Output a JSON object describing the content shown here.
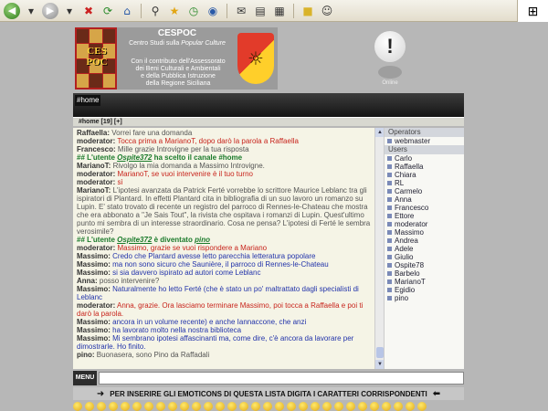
{
  "banner": {
    "title": "CESPOC",
    "subtitle_pre": "Centro Studi sulla ",
    "subtitle_em": "Popular Culture",
    "logo_text": "CES POC",
    "desc": [
      "Con il contributo dell'Assessorato",
      "dei Beni Culturali e Ambientali",
      "e della Pubblica Istruzione",
      "della Regione Siciliana"
    ]
  },
  "alert": {
    "label": "Online"
  },
  "tabs": {
    "home": "#home"
  },
  "channel": {
    "label": "#home [19] [+]"
  },
  "chat": [
    {
      "nick": "Raffaella:",
      "text": " Vorrei fare una domanda",
      "color": "c-gray"
    },
    {
      "nick": "moderator:",
      "text": " Tocca prima a MarianoT, dopo darò la parola a Raffaella",
      "color": "c-red"
    },
    {
      "nick": "Francesco:",
      "text": " Mille grazie Introvigne per la tua risposta",
      "color": "c-gray"
    },
    {
      "sys": true,
      "pre": "## L'utente ",
      "user": "Ospite372",
      "post": " ha scelto il canale #home"
    },
    {
      "nick": "MarianoT:",
      "text": " Rivolgo la mia domanda a Massimo Introvigne.",
      "color": "c-gray"
    },
    {
      "nick": "moderator:",
      "text": " MarianoT, se vuoi intervenire è il tuo turno",
      "color": "c-red"
    },
    {
      "nick": "moderator:",
      "text": " sì",
      "color": "c-red"
    },
    {
      "nick": "MarianoT:",
      "text": " L'ipotesi avanzata da Patrick Ferté vorrebbe lo scrittore Maurice Leblanc tra gli ispiratori di Plantard. In effetti Plantard cita in bibliografia di un suo lavoro un romanzo su Lupin. E' stato trovato di recente un registro del parroco di Rennes-le-Chateau che mostra che era abbonato a \"Je Sais Tout\", la rivista che ospitava i romanzi di Lupin. Quest'ultimo punto mi sembra di un interesse straordinario. Cosa ne pensa? L'ipotesi di Ferté le sembra verosimile?",
      "color": "c-gray"
    },
    {
      "sys": true,
      "pre": "## L'utente ",
      "user": "Ospite372",
      "post": " è diventato ",
      "user2": "pino"
    },
    {
      "nick": "moderator:",
      "text": " Massimo, grazie se vuoi rispondere a Mariano",
      "color": "c-red"
    },
    {
      "nick": "Massimo:",
      "text": " Credo che Plantard avesse letto parecchia letteratura popolare",
      "color": "c-blue"
    },
    {
      "nick": "Massimo:",
      "text": " ma non sono sicuro che Saunière, il parroco di Rennes-le-Chateau",
      "color": "c-blue"
    },
    {
      "nick": "Massimo:",
      "text": " si sia davvero ispirato ad autori come Leblanc",
      "color": "c-blue"
    },
    {
      "nick": "Anna:",
      "text": " posso intervenire?",
      "color": "c-gray"
    },
    {
      "nick": "Massimo:",
      "text": " Naturalmente ho letto Ferté (che è stato un po' maltrattato dagli specialisti di Leblanc",
      "color": "c-blue"
    },
    {
      "nick": "moderator:",
      "text": " Anna, grazie. Ora lasciamo terminare Massimo, poi tocca a Raffaella e poi ti darò la parola.",
      "color": "c-red"
    },
    {
      "nick": "Massimo:",
      "text": " ancora in un volume recente) e anche Iannaccone, che anzi",
      "color": "c-blue"
    },
    {
      "nick": "Massimo:",
      "text": " ha lavorato molto nella nostra biblioteca",
      "color": "c-blue"
    },
    {
      "nick": "Massimo:",
      "text": " Mi sembrano ipotesi affascinanti ma, come dire, c'è ancora da lavorare per dimostrarle. Ho finito.",
      "color": "c-blue"
    },
    {
      "nick": "pino:",
      "text": " Buonasera, sono Pino da Raffadali",
      "color": "c-gray"
    }
  ],
  "userlist": {
    "operators_header": "Operators",
    "operators": [
      "webmaster"
    ],
    "users_header": "Users",
    "users": [
      "Carlo",
      "Raffaella",
      "Chiara",
      "RL",
      "Carmelo",
      "Anna",
      "Francesco",
      "Ettore",
      "moderator",
      "Massimo",
      "Andrea",
      "Adele",
      "Giulio",
      "Ospite78",
      "Barbelo",
      "MarianoT",
      "Egidio",
      "pino"
    ]
  },
  "input": {
    "menu_label": "MENU",
    "value": ""
  },
  "emoticon_bar": {
    "text": "PER INSERIRE GLI EMOTICONS DI QUESTA LISTA DIGITA I CARATTERI CORRISPONDENTI"
  }
}
